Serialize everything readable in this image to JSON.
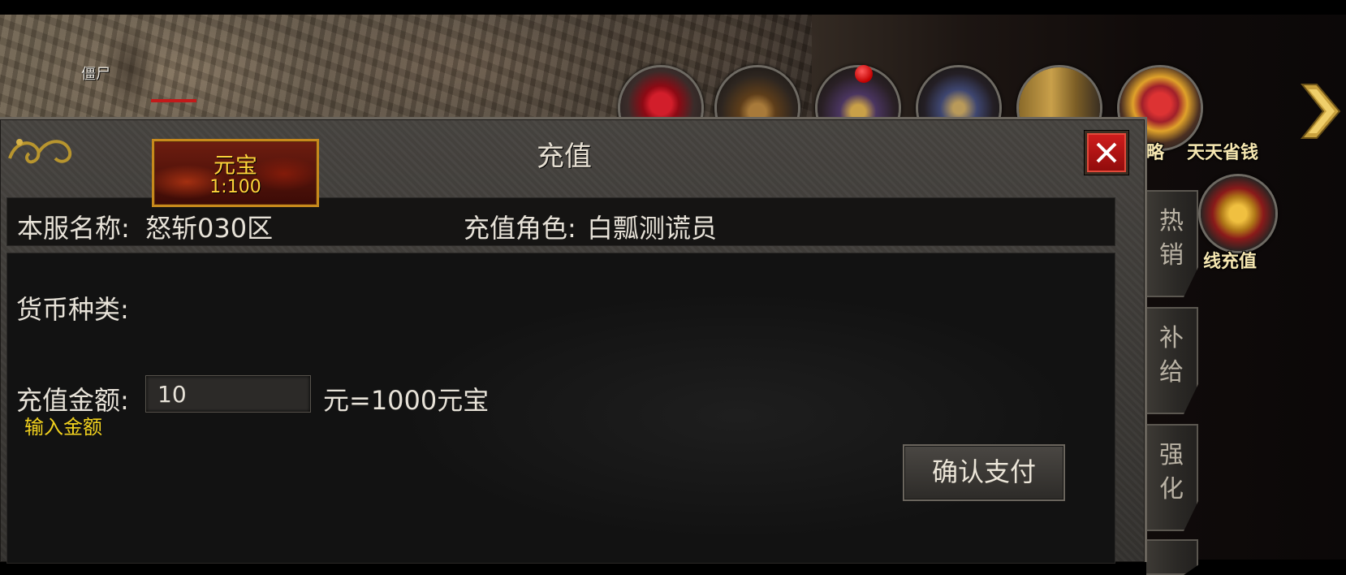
{
  "scene": {
    "monster_name": "僵尸"
  },
  "top_icons": [
    {
      "name": "rose-icon",
      "label": ""
    },
    {
      "name": "helmet-icon",
      "label": ""
    },
    {
      "name": "armor-icon",
      "label": ""
    },
    {
      "name": "weapon-icon",
      "label": ""
    },
    {
      "name": "strategy-icon",
      "label": "略"
    },
    {
      "name": "gift-box-icon",
      "label": "天天省钱"
    },
    {
      "name": "gold-ingot-icon",
      "label": "线充值"
    }
  ],
  "side_tabs": [
    {
      "label": "热\n销"
    },
    {
      "label": "补\n给"
    },
    {
      "label": "强\n化"
    }
  ],
  "dialog": {
    "title": "充值",
    "server_label": "本服名称:",
    "server_value": "怒斩030区",
    "role_label": "充值角色:",
    "role_value": "白瓢测谎员",
    "currency_label": "货币种类:",
    "currency_name": "元宝",
    "currency_rate": "1:100",
    "amount_label": "充值金额:",
    "amount_value": "10",
    "amount_hint": "输入金额",
    "conversion_text": "元=1000元宝",
    "confirm_label": "确认支付"
  },
  "colors": {
    "accent_gold": "#ffd33a",
    "hint_yellow": "#f2d21e",
    "close_red": "#d11d1d"
  }
}
